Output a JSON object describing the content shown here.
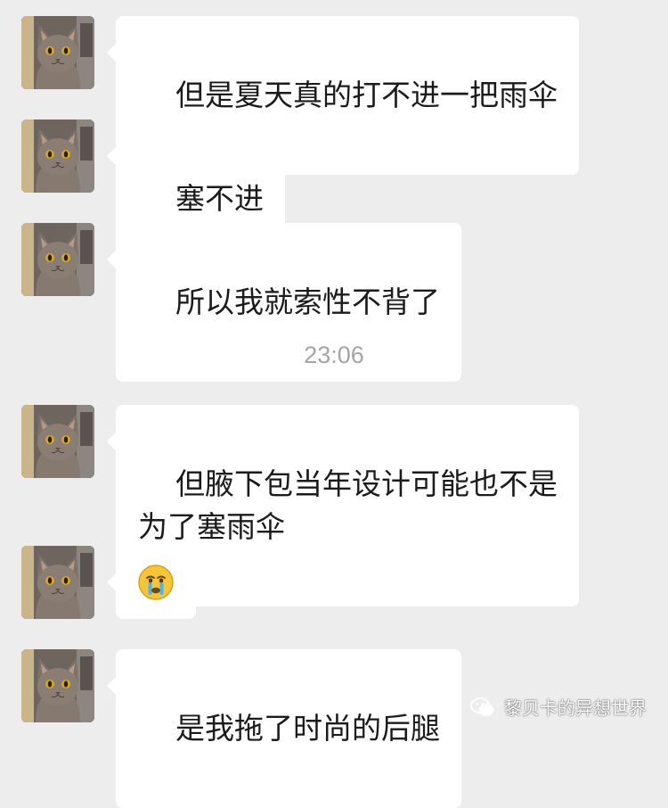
{
  "messages": [
    {
      "text": "但是夏天真的打不进一把雨伞"
    },
    {
      "text": "塞不进"
    },
    {
      "text": "所以我就索性不背了"
    },
    {
      "text": "但腋下包当年设计可能也不是\n为了塞雨伞"
    },
    {
      "emoji": "crying-face"
    },
    {
      "text": "是我拖了时尚的后腿"
    }
  ],
  "timestamp": "23:06",
  "watermark": {
    "text": "黎贝卡的异想世界",
    "icon": "wechat-icon"
  },
  "colors": {
    "background": "#ededed",
    "bubble": "#ffffff",
    "text": "#1b1b1b",
    "timestamp": "#a5a5a5"
  }
}
